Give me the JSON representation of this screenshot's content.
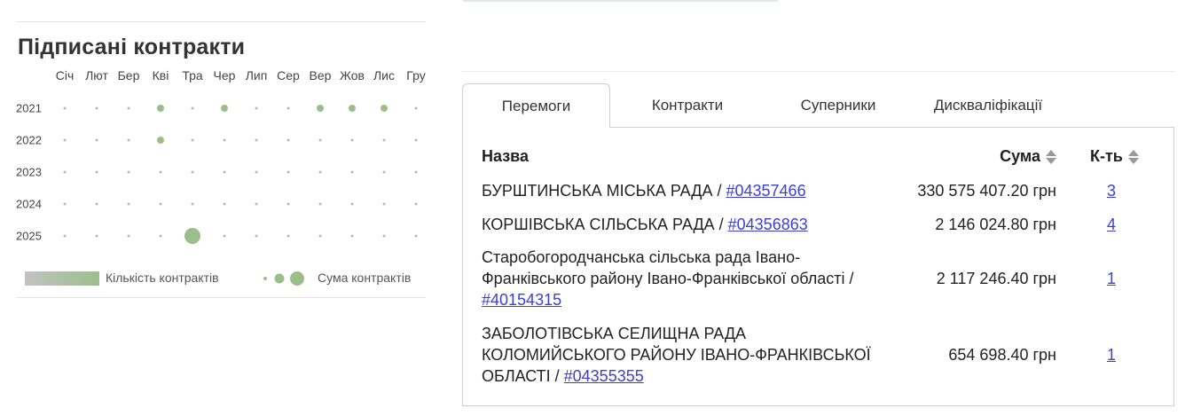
{
  "signed_contracts": {
    "title": "Підписані контракти",
    "months": [
      "Січ",
      "Лют",
      "Бер",
      "Кві",
      "Тра",
      "Чер",
      "Лип",
      "Сер",
      "Вер",
      "Жов",
      "Лис",
      "Гру"
    ],
    "years": [
      "2021",
      "2022",
      "2023",
      "2024",
      "2025"
    ],
    "dot_colors": {
      "empty": "#b8b8b8",
      "filled": "#9bbf8a"
    },
    "cells": [
      {
        "year": "2021",
        "month": "Кві",
        "level": 1
      },
      {
        "year": "2021",
        "month": "Чер",
        "level": 1
      },
      {
        "year": "2021",
        "month": "Вер",
        "level": 1
      },
      {
        "year": "2021",
        "month": "Жов",
        "level": 1
      },
      {
        "year": "2021",
        "month": "Лис",
        "level": 1
      },
      {
        "year": "2022",
        "month": "Кві",
        "level": 1
      },
      {
        "year": "2025",
        "month": "Тра",
        "level": 3
      }
    ],
    "legend": {
      "count_label": "Кількість контрактів",
      "sum_label": "Сума контрактів",
      "gradient_from": "#c2c2c2",
      "gradient_to": "#9bbf8a"
    }
  },
  "tabs": [
    {
      "label": "Перемоги",
      "active": true
    },
    {
      "label": "Контракти",
      "active": false
    },
    {
      "label": "Суперники",
      "active": false
    },
    {
      "label": "Дискваліфікації",
      "active": false
    }
  ],
  "table": {
    "headers": {
      "name": "Назва",
      "sum": "Сума",
      "count": "К-ть"
    },
    "rows": [
      {
        "name": "БУРШТИНСЬКА МІСЬКА РАДА / ",
        "code": "#04357466",
        "sum": "330 575 407.20 грн",
        "count": "3"
      },
      {
        "name": "КОРШІВСЬКА СІЛЬСЬКА РАДА / ",
        "code": "#04356863",
        "sum": "2 146 024.80 грн",
        "count": "4"
      },
      {
        "name": "Старобогородчанська сільська рада Івано-Франківського району Івано-Франківської області / ",
        "code": "#40154315",
        "sum": "2 117 246.40 грн",
        "count": "1"
      },
      {
        "name": "ЗАБОЛОТІВСЬКА СЕЛИЩНА РАДА КОЛОМИЙСЬКОГО РАЙОНУ ІВАНО-ФРАНКІВСЬКОЇ ОБЛАСТІ / ",
        "code": "#04355355",
        "sum": "654 698.40 грн",
        "count": "1"
      }
    ]
  },
  "colors": {
    "link": "#3b3fd8",
    "accent": "#9bbf8a",
    "border": "#cfcfcf"
  }
}
